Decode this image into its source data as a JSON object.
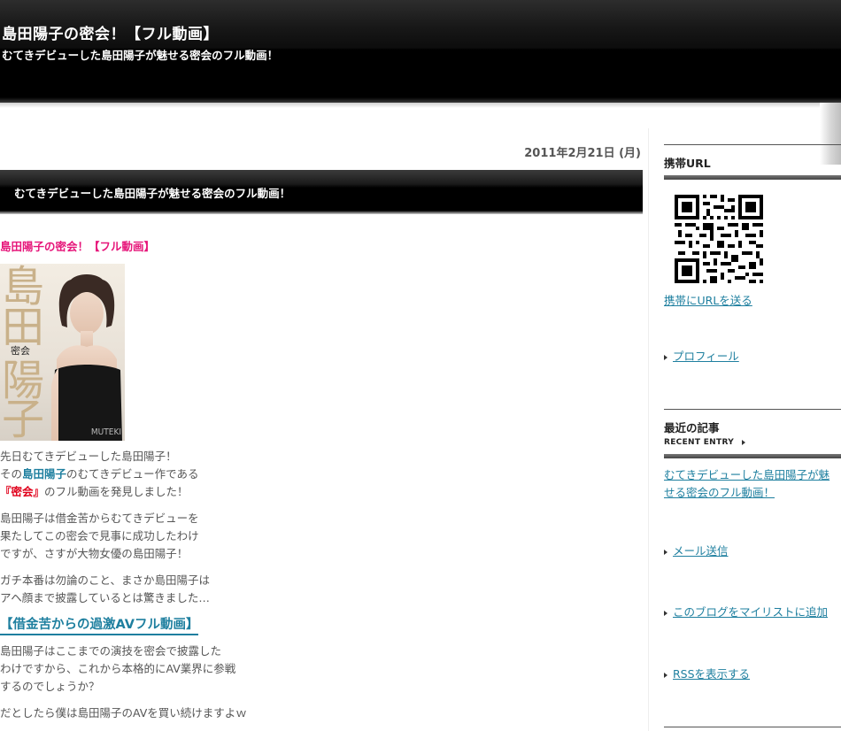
{
  "header": {
    "site_title": "島田陽子の密会！【フル動画】",
    "site_description": "むてきデビューした島田陽子が魅せる密会のフル動画！"
  },
  "post": {
    "date": "2011年2月21日 (月)",
    "title": "むてきデビューした島田陽子が魅せる密会のフル動画！",
    "pink_title": "島田陽子の密会！【フル動画】",
    "cover": {
      "kanji1": "島",
      "kanji2": "田",
      "kanji3": "陽",
      "kanji4": "子",
      "sub": "密会",
      "brand": "MUTEKI"
    },
    "p1_line1": "先日むてきデビューした島田陽子！",
    "p1_line2_pre": "その",
    "p1_line2_link": "島田陽子",
    "p1_line2_post": "のむてきデビュー作である",
    "p1_line3_link": "『密会』",
    "p1_line3_post": "のフル動画を発見しました！",
    "p2_line1": "島田陽子は借金苦からむてきデビューを",
    "p2_line2": "果たしてこの密会で見事に成功したわけ",
    "p2_line3": "ですが、さすが大物女優の島田陽子！",
    "p3_line1": "ガチ本番は勿論のこと、まさか島田陽子は",
    "p3_line2": "アヘ顔まで披露しているとは驚きました…",
    "big_link": "【借金苦からの過激AVフル動画】",
    "p4_line1": "島田陽子はここまでの演技を密会で披露した",
    "p4_line2": "わけですから、これから本格的にAV業界に参戦",
    "p4_line3": "するのでしょうか？",
    "p5_line1": "だとしたら僕は島田陽子のAVを買い続けますよｗ"
  },
  "sidebar": {
    "mobile_heading": "携帯URL",
    "send_mobile_link": "携帯にURLを送る",
    "profile_link": "プロフィール",
    "recent_heading": "最近の記事",
    "recent_sub": "RECENT ENTRY",
    "recent_item_line1": "むてきデビューした島田陽子が魅",
    "recent_item_line2": "せる密会のフル動画！",
    "mail_link": "メール送信",
    "mylist_link": "このブログをマイリストに追加",
    "rss_link": "RSSを表示する"
  }
}
